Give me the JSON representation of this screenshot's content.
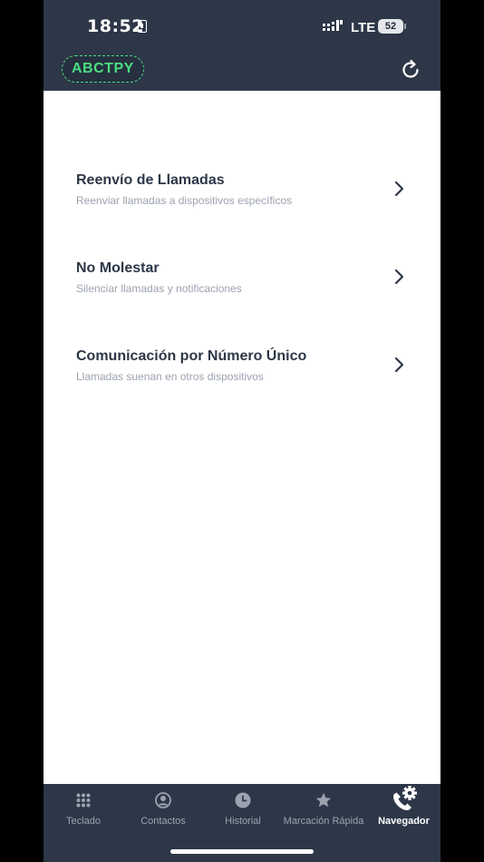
{
  "status": {
    "time": "18:52",
    "network": "LTE",
    "battery": "52"
  },
  "header": {
    "brand": "ABCTPY",
    "refresh_icon": "refresh-icon"
  },
  "menu": [
    {
      "title": "Reenvío de Llamadas",
      "subtitle": "Reenviar llamadas a dispositivos específicos"
    },
    {
      "title": "No Molestar",
      "subtitle": "Silenciar llamadas y notificaciones"
    },
    {
      "title": "Comunicación por Número Único",
      "subtitle": "Llamadas suenan en otros dispositivos"
    }
  ],
  "tabs": [
    {
      "label": "Teclado",
      "icon": "keypad-icon"
    },
    {
      "label": "Contactos",
      "icon": "contact-icon"
    },
    {
      "label": "Historial",
      "icon": "clock-icon"
    },
    {
      "label": "Marcación Rápida",
      "icon": "star-icon"
    },
    {
      "label": "Navegador",
      "icon": "phone-gear-icon",
      "active": true
    }
  ],
  "colors": {
    "brand": "#4ade80",
    "bar": "#2d3748",
    "text": "#2d3748",
    "muted": "#9ca3af"
  }
}
